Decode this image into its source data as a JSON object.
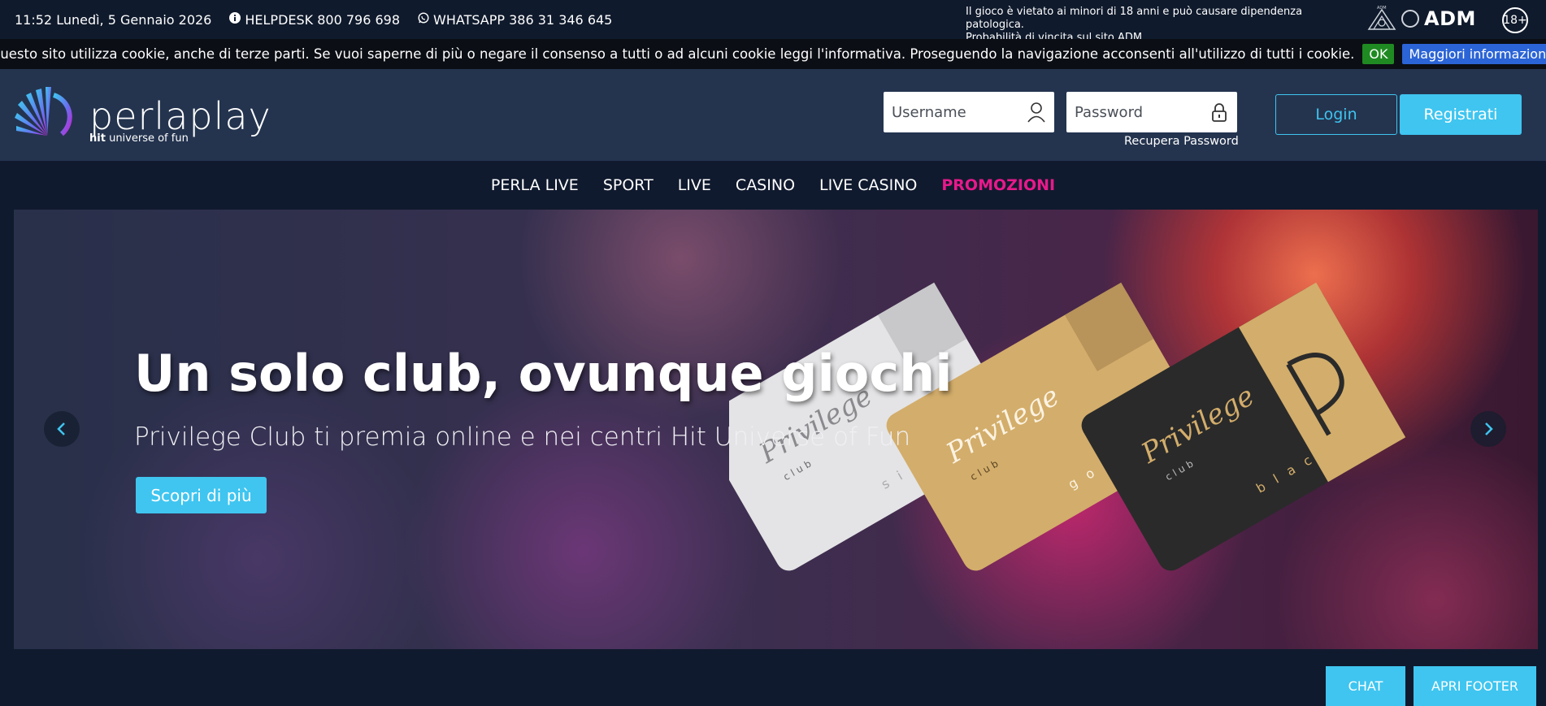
{
  "topbar": {
    "datetime": "11:52 Lunedì, 5 Gennaio 2026",
    "helpdesk": "HELPDESK 800 796 698",
    "whatsapp": "WHATSAPP 386 31 346 645",
    "legal_line1": "Il gioco è vietato ai minori di 18 anni e può causare dipendenza patologica.",
    "legal_line2": "Probabilità di vincita sul sito ADM.",
    "adm_label": "ADM",
    "age_badge": "18+"
  },
  "cookie": {
    "text": "Questo sito utilizza cookie, anche di terze parti. Se vuoi saperne di più o negare il consenso a tutti o ad alcuni cookie leggi l'informativa. Proseguendo la navigazione acconsenti all'utilizzo di tutti i cookie.",
    "ok_label": "OK",
    "more_label": "Maggiori informazioni"
  },
  "header": {
    "logo_word": "perlaplay",
    "logo_sub_brand": "hit",
    "logo_sub_text": "universe of fun",
    "username_placeholder": "Username",
    "password_placeholder": "Password",
    "recover_label": "Recupera Password",
    "login_label": "Login",
    "register_label": "Registrati"
  },
  "nav": {
    "items": [
      "PERLA LIVE",
      "SPORT",
      "LIVE",
      "CASINO",
      "LIVE CASINO",
      "PROMOZIONI"
    ]
  },
  "hero": {
    "title": "Un solo club, ovunque giochi",
    "subtitle": "Privilege Club ti premia online e nei centri Hit Universe of Fun",
    "cta_label": "Scopri di più",
    "cards": [
      {
        "brand": "Privilege",
        "club": "club",
        "tier": "silver",
        "color": "#e4e4e6"
      },
      {
        "brand": "Privilege",
        "club": "club",
        "tier": "gold",
        "color": "#d3ad6b"
      },
      {
        "brand": "Privilege",
        "club": "club",
        "tier": "black",
        "color": "#2a2a2a"
      }
    ]
  },
  "bottom": {
    "chat_label": "CHAT",
    "footer_label": "APRI FOOTER"
  },
  "colors": {
    "accent": "#3fc5f0",
    "promo": "#e8198b",
    "header_bg": "#24344f",
    "topbar_bg": "#0f1a2c"
  }
}
